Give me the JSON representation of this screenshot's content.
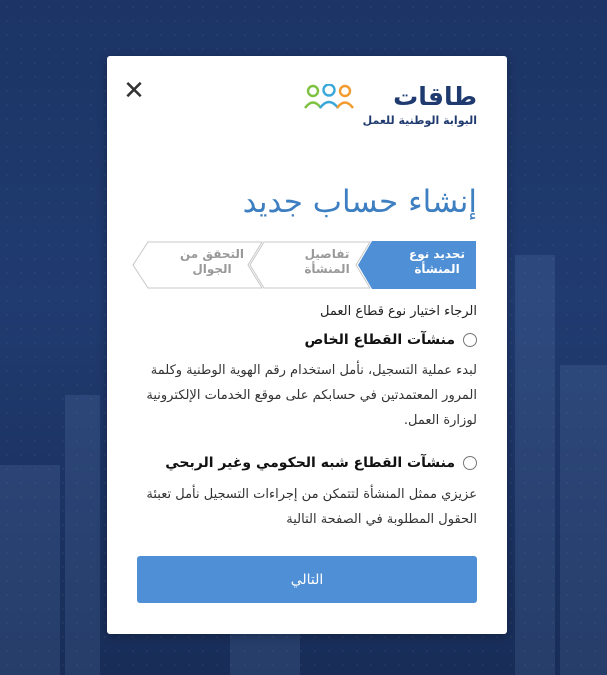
{
  "modal": {
    "logo": {
      "brand": "طاقات",
      "tagline": "البوابة الوطنية للعمل"
    },
    "title": "إنشاء حساب جديد",
    "steps": [
      {
        "label": "تحديد نوع المنشأة",
        "active": true
      },
      {
        "label": "تفاصيل المنشأة",
        "active": false
      },
      {
        "label": "التحقق من الجوال",
        "active": false
      }
    ],
    "instruction": "الرجاء اختيار نوع قطاع العمل",
    "options": [
      {
        "label": "منشآت القطاع الخاص",
        "description": "لبدء عملية التسجيل، نأمل استخدام رقم الهوية الوطنية وكلمة المرور المعتمدتين في حسابكم على موقع الخدمات الإلكترونية لوزارة العمل."
      },
      {
        "label": "منشآت القطاع شبه الحكومي وغير الربحي",
        "description": "عزيزي ممثل المنشأة لتتمكن من إجراءات التسجيل نأمل تعبئة الحقول المطلوبة في الصفحة التالية"
      }
    ],
    "next_button": "التالي",
    "close_symbol": "✕"
  },
  "colors": {
    "accent": "#4f8fd6",
    "title": "#3e7fc1",
    "brand": "#1f3a6e",
    "step_inactive_text": "#999999"
  }
}
